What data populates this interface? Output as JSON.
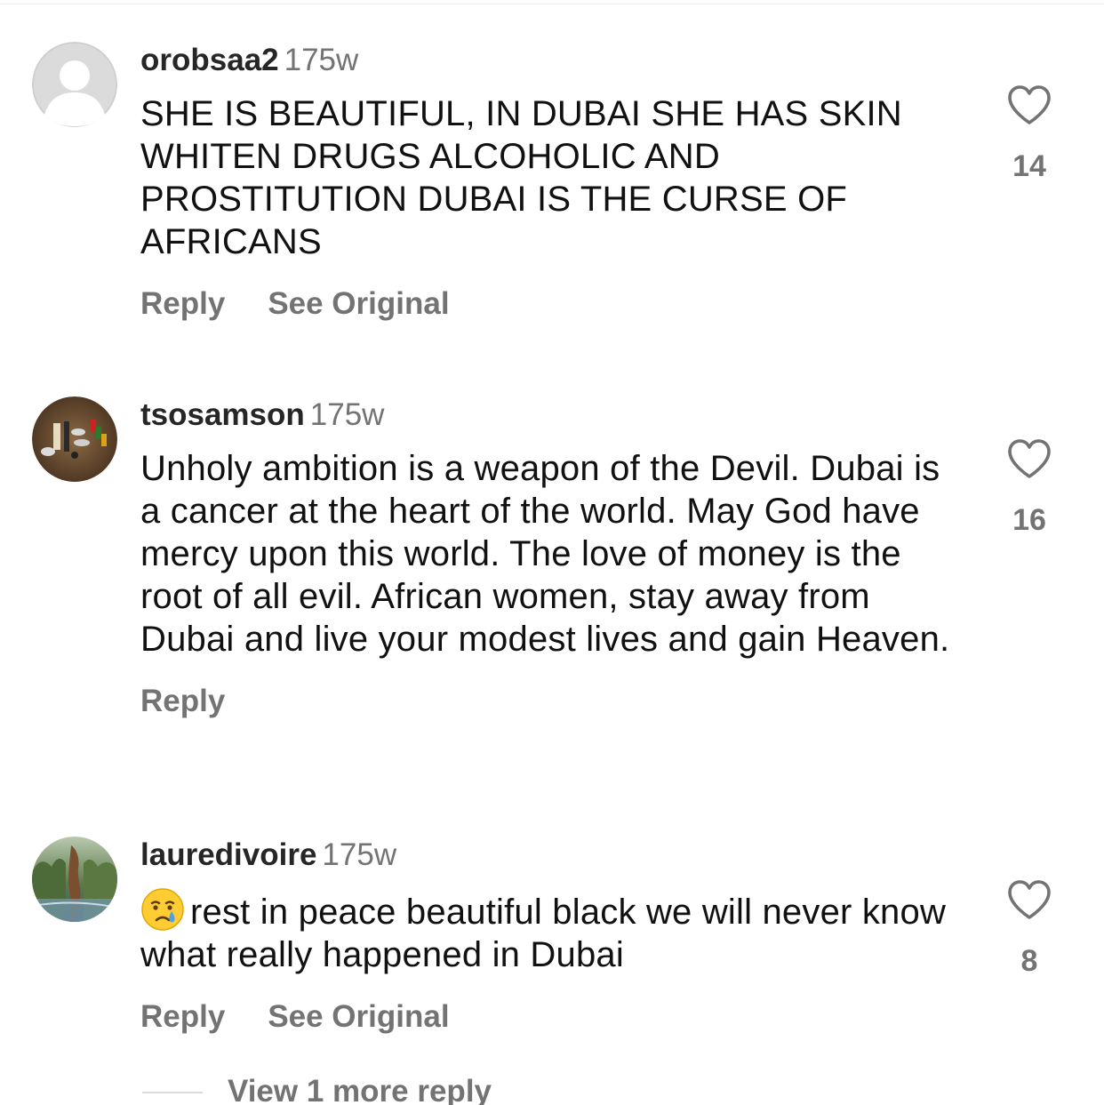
{
  "comments": [
    {
      "username": "orobsaa2",
      "time": "175w",
      "text": "SHE IS BEAUTIFUL, IN DUBAI SHE HAS SKIN WHITEN DRUGS ALCOHOLIC AND PROSTITUTION DUBAI IS THE CURSE OF AFRICANS",
      "likes": "14",
      "reply_label": "Reply",
      "see_original_label": "See Original",
      "avatar": "default-profile-icon"
    },
    {
      "username": "tsosamson",
      "time": "175w",
      "text": "Unholy ambition is a weapon of the Devil. Dubai is a cancer at the heart of the world. May God have mercy upon this world. The love of money is the root of all evil. African women, stay away from Dubai and live your modest lives and gain Heaven.",
      "likes": "16",
      "reply_label": "Reply",
      "avatar": "photo-avatar"
    },
    {
      "username": "lauredivoire",
      "time": "175w",
      "emoji": "crying-face-emoji",
      "text": "rest in peace beautiful black we will never know what really happened in Dubai",
      "likes": "8",
      "reply_label": "Reply",
      "see_original_label": "See Original",
      "avatar": "photo-avatar"
    }
  ],
  "view_more_replies": "View 1 more reply",
  "colors": {
    "text": "#111111",
    "secondary": "#737373",
    "divider": "#dbdbdb"
  }
}
